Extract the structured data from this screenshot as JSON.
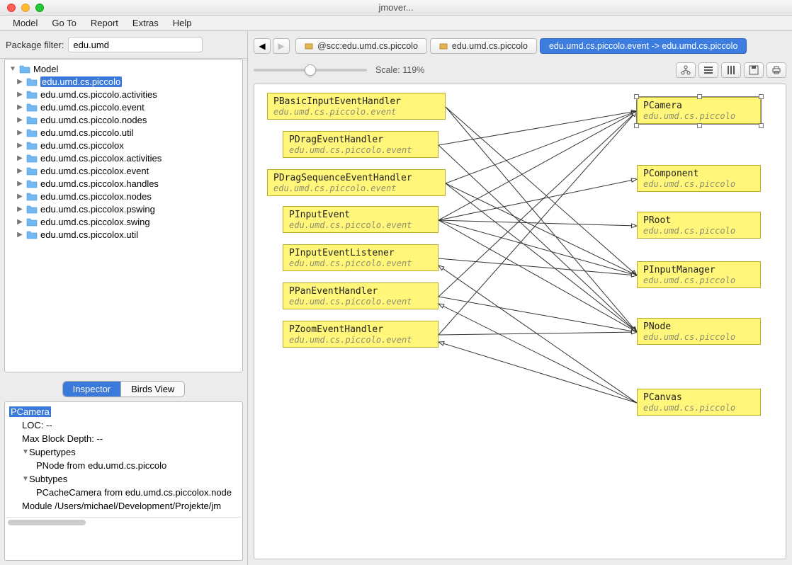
{
  "window": {
    "title": "jmover..."
  },
  "menubar": [
    "Model",
    "Go To",
    "Report",
    "Extras",
    "Help"
  ],
  "filter": {
    "label": "Package filter:",
    "value": "edu.umd"
  },
  "tree": {
    "root": "Model",
    "items": [
      "edu.umd.cs.piccolo",
      "edu.umd.cs.piccolo.activities",
      "edu.umd.cs.piccolo.event",
      "edu.umd.cs.piccolo.nodes",
      "edu.umd.cs.piccolo.util",
      "edu.umd.cs.piccolox",
      "edu.umd.cs.piccolox.activities",
      "edu.umd.cs.piccolox.event",
      "edu.umd.cs.piccolox.handles",
      "edu.umd.cs.piccolox.nodes",
      "edu.umd.cs.piccolox.pswing",
      "edu.umd.cs.piccolox.swing",
      "edu.umd.cs.piccolox.util"
    ],
    "selected_index": 0
  },
  "tabs": {
    "inspector": "Inspector",
    "birdsview": "Birds View"
  },
  "inspector": {
    "selected": "PCamera",
    "loc": "LOC: --",
    "maxblock": "Max Block Depth: --",
    "supertypes_label": "Supertypes",
    "supertype1": "PNode from edu.umd.cs.piccolo",
    "subtypes_label": "Subtypes",
    "subtype1": "PCacheCamera from edu.umd.cs.piccolox.node",
    "module": "Module /Users/michael/Development/Projekte/jm"
  },
  "topTabs": {
    "t1": "@scc:edu.umd.cs.piccolo",
    "t2": "edu.umd.cs.piccolo",
    "t3": "edu.umd.cs.piccolo.event -> edu.umd.cs.piccolo"
  },
  "scale": {
    "label": "Scale: 119%"
  },
  "nodes": {
    "left": [
      {
        "title": "PBasicInputEventHandler",
        "sub": "edu.umd.cs.piccolo.event"
      },
      {
        "title": "PDragEventHandler",
        "sub": "edu.umd.cs.piccolo.event"
      },
      {
        "title": "PDragSequenceEventHandler",
        "sub": "edu.umd.cs.piccolo.event"
      },
      {
        "title": "PInputEvent",
        "sub": "edu.umd.cs.piccolo.event"
      },
      {
        "title": "PInputEventListener",
        "sub": "edu.umd.cs.piccolo.event"
      },
      {
        "title": "PPanEventHandler",
        "sub": "edu.umd.cs.piccolo.event"
      },
      {
        "title": "PZoomEventHandler",
        "sub": "edu.umd.cs.piccolo.event"
      }
    ],
    "right": [
      {
        "title": "PCamera",
        "sub": "edu.umd.cs.piccolo"
      },
      {
        "title": "PComponent",
        "sub": "edu.umd.cs.piccolo"
      },
      {
        "title": "PRoot",
        "sub": "edu.umd.cs.piccolo"
      },
      {
        "title": "PInputManager",
        "sub": "edu.umd.cs.piccolo"
      },
      {
        "title": "PNode",
        "sub": "edu.umd.cs.piccolo"
      },
      {
        "title": "PCanvas",
        "sub": "edu.umd.cs.piccolo"
      }
    ]
  }
}
